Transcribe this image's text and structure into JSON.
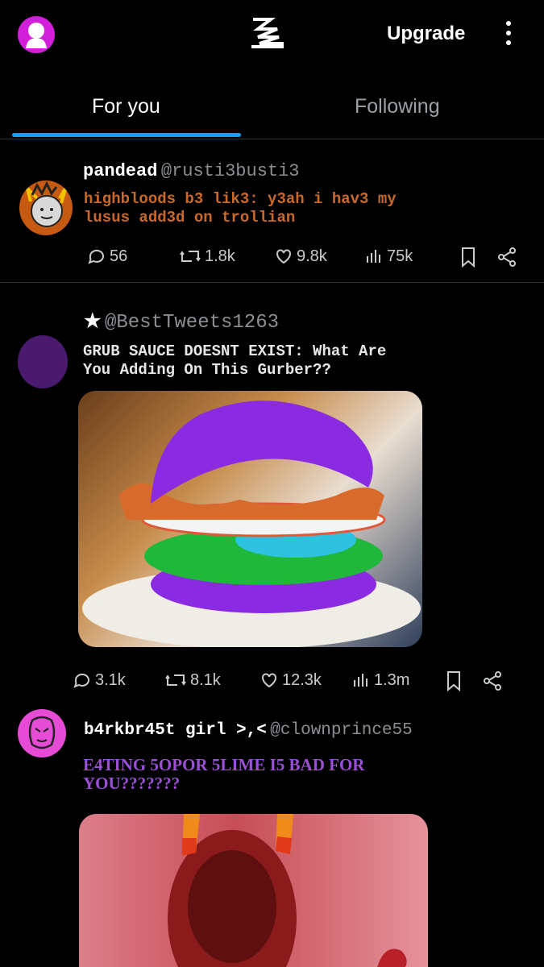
{
  "header": {
    "upgrade_label": "Upgrade"
  },
  "tabs": [
    {
      "label": "For you",
      "active": true
    },
    {
      "label": "Following",
      "active": false
    }
  ],
  "posts": [
    {
      "name": "pandead",
      "handle": "@rusti3busti3",
      "text_line1": "highbloods b3 lik3: y3ah i hav3 my",
      "text_line2": "lusus add3d on trollian",
      "text_color": "#c8692a",
      "replies": "56",
      "reposts": "1.8k",
      "likes": "9.8k",
      "views": "75k"
    },
    {
      "name": "★",
      "handle": "@BestTweets1263",
      "text_line1": "GRUB SAUCE DOESNT EXIST: What Are",
      "text_line2": "You Adding On This Gurber??",
      "text_color": "#e6e6e6",
      "replies": "3.1k",
      "reposts": "8.1k",
      "likes": "12.3k",
      "views": "1.3m"
    },
    {
      "name": "b4rkbr45t girl >,<",
      "handle": "@clownprince55",
      "text_line1": "E4TING 5OPOR 5LIME I5 BAD FOR",
      "text_line2": "YOU???????",
      "text_color": "#9a4fd6"
    }
  ],
  "colors": {
    "accent": "#1d9bf0",
    "profile_bg": "#d21fd9",
    "avatar2": "#4a1a6e"
  }
}
